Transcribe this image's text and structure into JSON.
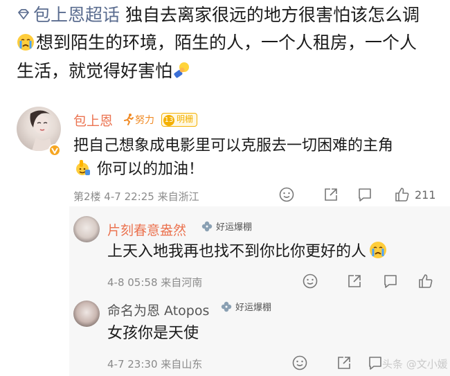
{
  "post": {
    "topic": "包上恩超话",
    "line1": "独自去离家很远的地方很害怕该怎么调",
    "line2": "想到陌生的环境，陌生的人，一个人租房，一个人",
    "line3": "生活，就觉得好害怕"
  },
  "comments": [
    {
      "name": "包上恩",
      "badge": "努力",
      "level_number": "13",
      "level_label": "明栅",
      "text_line1": "把自己想象成电影里可以克服去一切困难的主角",
      "text_line2": "你可以的加油！",
      "meta": "第2楼  4-7 22:25  来自浙江",
      "likes": "211"
    }
  ],
  "replies": [
    {
      "name": "片刻春意盎然",
      "lucky_badge": "好运爆棚",
      "text": "上天入地我再也找不到你比你更好的人",
      "meta": "4-8 05:58  来自河南"
    },
    {
      "name": "命名为恩 Atopos",
      "lucky_badge": "好运爆棚",
      "text": "女孩你是天使",
      "meta": "4-7 23:30  来自山东"
    }
  ],
  "watermark": "头条 @文小媛",
  "colors": {
    "name": "#eb7350",
    "topic": "#5a6c8f",
    "level": "#f4b000",
    "meta": "#8a8a8a",
    "reply_bg": "#f7f7f7"
  },
  "icons": [
    "topic-diamond-icon",
    "crying-emoji-icon",
    "fist-bump-emoji-icon",
    "running-man-icon",
    "verified-badge-icon",
    "thumbs-up-emoji-icon",
    "clover-icon",
    "smile-face-icon",
    "share-icon",
    "comment-icon",
    "like-icon"
  ]
}
